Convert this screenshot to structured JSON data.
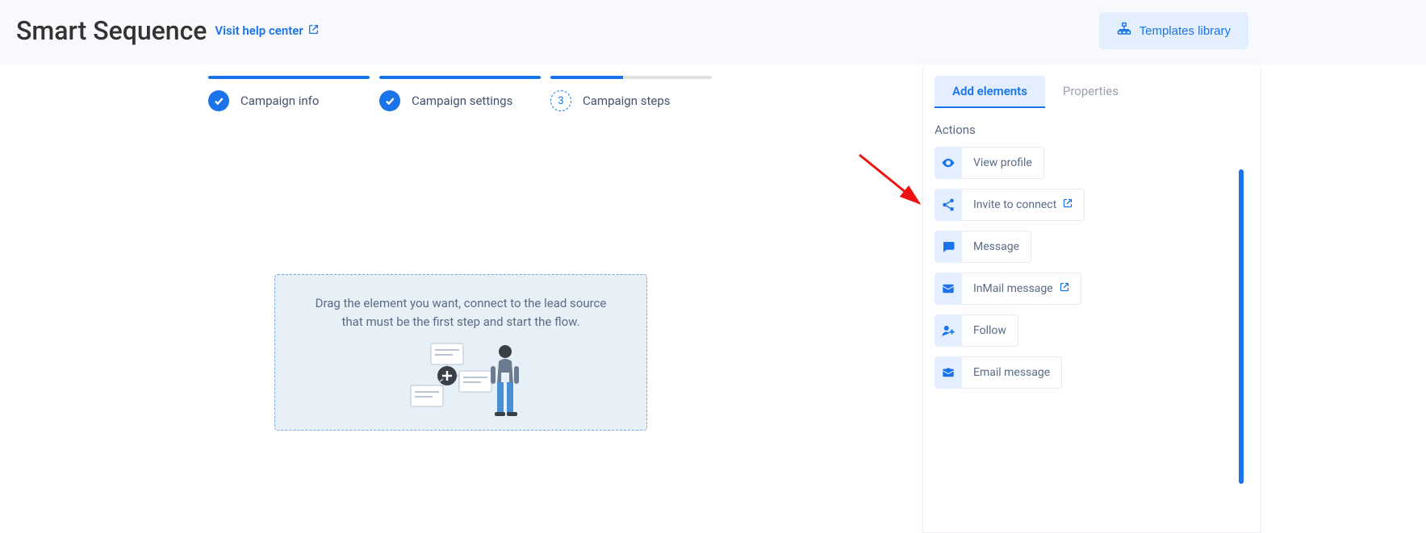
{
  "header": {
    "title": "Smart Sequence",
    "help_link": "Visit help center",
    "templates_button": "Templates library"
  },
  "steps": [
    {
      "label": "Campaign info",
      "state": "done"
    },
    {
      "label": "Campaign settings",
      "state": "done"
    },
    {
      "label": "Campaign steps",
      "state": "current",
      "number": "3"
    }
  ],
  "canvas": {
    "instruction": "Drag the element you want, connect to the lead source that must be the first step and start the flow."
  },
  "side_panel": {
    "tabs": {
      "add_elements": "Add elements",
      "properties": "Properties"
    },
    "section_title": "Actions",
    "actions": [
      {
        "icon": "eye-icon",
        "label": "View profile",
        "external": false
      },
      {
        "icon": "share-icon",
        "label": "Invite to connect",
        "external": true
      },
      {
        "icon": "chat-icon",
        "label": "Message",
        "external": false
      },
      {
        "icon": "inmail-icon",
        "label": "InMail message",
        "external": true
      },
      {
        "icon": "follow-icon",
        "label": "Follow",
        "external": false
      },
      {
        "icon": "email-icon",
        "label": "Email message",
        "external": false
      }
    ]
  }
}
